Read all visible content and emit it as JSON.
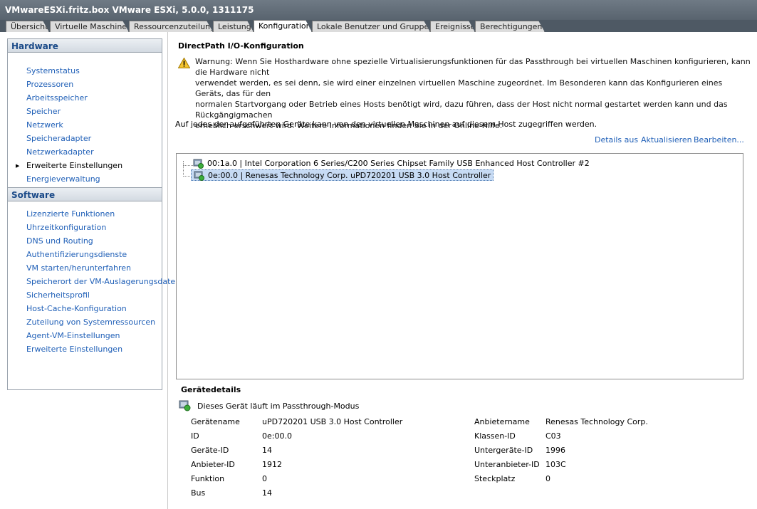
{
  "window": {
    "title": "VMwareESXi.fritz.box VMware ESXi, 5.0.0, 1311175"
  },
  "tabs": [
    {
      "label": "Übersicht"
    },
    {
      "label": "Virtuelle Maschinen"
    },
    {
      "label": "Ressourcenzuteilung"
    },
    {
      "label": "Leistung"
    },
    {
      "label": "Konfiguration"
    },
    {
      "label": "Lokale Benutzer und Gruppen"
    },
    {
      "label": "Ereignisse"
    },
    {
      "label": "Berechtigungen"
    }
  ],
  "hardware": {
    "title": "Hardware",
    "items": [
      {
        "label": "Systemstatus"
      },
      {
        "label": "Prozessoren"
      },
      {
        "label": "Arbeitsspeicher"
      },
      {
        "label": "Speicher"
      },
      {
        "label": "Netzwerk"
      },
      {
        "label": "Speicheradapter"
      },
      {
        "label": "Netzwerkadapter"
      },
      {
        "label": "Erweiterte Einstellungen"
      },
      {
        "label": "Energieverwaltung"
      }
    ]
  },
  "software": {
    "title": "Software",
    "items": [
      {
        "label": "Lizenzierte Funktionen"
      },
      {
        "label": "Uhrzeitkonfiguration"
      },
      {
        "label": "DNS und Routing"
      },
      {
        "label": "Authentifizierungsdienste"
      },
      {
        "label": "VM starten/herunterfahren"
      },
      {
        "label": "Speicherort der VM-Auslagerungsdatei"
      },
      {
        "label": "Sicherheitsprofil"
      },
      {
        "label": "Host-Cache-Konfiguration"
      },
      {
        "label": "Zuteilung von Systemressourcen"
      },
      {
        "label": "Agent-VM-Einstellungen"
      },
      {
        "label": "Erweiterte Einstellungen"
      }
    ]
  },
  "main": {
    "title": "DirectPath I/O-Konfiguration",
    "warning_line1": "Warnung: Wenn Sie Hosthardware ohne spezielle Virtualisierungsfunktionen für das Passthrough bei virtuellen Maschinen konfigurieren, kann die Hardware nicht",
    "warning_line2": "verwendet werden, es sei denn, sie wird einer einzelnen virtuellen Maschine zugeordnet. Im Besonderen kann das Konfigurieren eines Geräts, das für den",
    "warning_line3": "normalen Startvorgang oder Betrieb eines Hosts benötigt wird, dazu führen, dass der Host nicht normal gestartet werden kann und das Rückgängigmachen",
    "warning_line4": "erheblich erschwert wird. Weitere Informationen finden Sie in der Online-Hilfe.",
    "info": "Auf jedes der aufgeführten Geräte kann von den virtuellen Maschinen auf diesem Host zugegriffen werden.",
    "actions": {
      "details_off": "Details aus",
      "refresh": "Aktualisieren",
      "edit": "Bearbeiten..."
    },
    "devices": [
      {
        "label": "00:1a.0 | Intel Corporation 6 Series/C200 Series Chipset Family USB Enhanced Host Controller #2"
      },
      {
        "label": "0e:00.0 | Renesas Technology Corp. uPD720201 USB 3.0 Host Controller"
      }
    ]
  },
  "details": {
    "title": "Gerätedetails",
    "status": "Dieses Gerät läuft im Passthrough-Modus",
    "left": [
      {
        "label": "Gerätename",
        "value": "uPD720201 USB 3.0 Host Controller"
      },
      {
        "label": "ID",
        "value": "0e:00.0"
      },
      {
        "label": "Geräte-ID",
        "value": "14"
      },
      {
        "label": "Anbieter-ID",
        "value": "1912"
      },
      {
        "label": "Funktion",
        "value": "0"
      },
      {
        "label": "Bus",
        "value": "14"
      }
    ],
    "right": [
      {
        "label": "Anbietername",
        "value": "Renesas Technology Corp."
      },
      {
        "label": "Klassen-ID",
        "value": "C03"
      },
      {
        "label": "Untergeräte-ID",
        "value": "1996"
      },
      {
        "label": "Unteranbieter-ID",
        "value": "103C"
      },
      {
        "label": "Steckplatz",
        "value": "0"
      }
    ]
  },
  "colors": {
    "link": "#1f5fb7",
    "panel_header_text": "#1a4a88",
    "selection": "#c7dbf4",
    "titlebar": "#58636e"
  }
}
